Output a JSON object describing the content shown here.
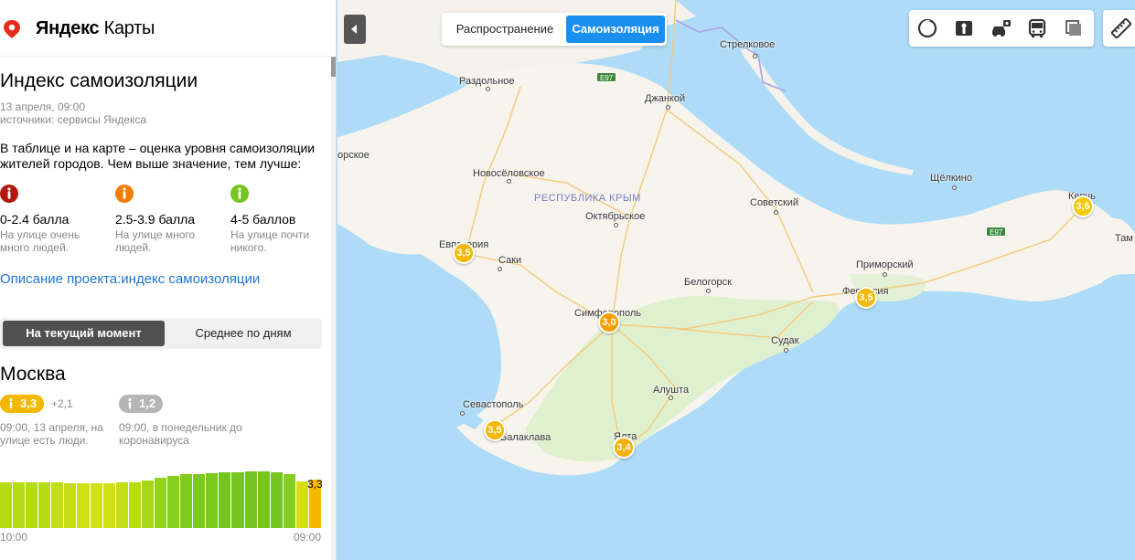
{
  "app": {
    "logo_bold": "Яндекс",
    "logo_rest": " Карты"
  },
  "panel": {
    "title": "Индекс самоизоляции",
    "date": "13 апреля, 09:00",
    "sources": "источники: сервисы Яндекса",
    "description": "В таблице и на карте – оценка уровня самоизоляции жителей городов. Чем выше значение, тем лучше:",
    "legend": [
      {
        "range": "0-2.4 балла",
        "note": "На улице очень много людей.",
        "color": "#b3190e"
      },
      {
        "range": "2.5-3.9 балла",
        "note": "На улице много людей.",
        "color": "#f57c00"
      },
      {
        "range": "4-5 баллов",
        "note": "На улице почти никого.",
        "color": "#76c41f"
      }
    ],
    "project_link": "Описание проекта:индекс самоизоляции",
    "tabs": {
      "current": "На текущий момент",
      "daily": "Среднее по дням"
    },
    "city": {
      "name": "Москва",
      "current_value": "3,3",
      "delta": "+2,1",
      "baseline_value": "1,2",
      "current_note": "09:00, 13 апреля, на улице есть люди.",
      "baseline_note": "09:00, в понедельник до коронавируса"
    },
    "hourly_chart": {
      "last_label": "3,3",
      "tick_start": "10:00",
      "tick_end": "09:00"
    }
  },
  "chart_data": {
    "type": "bar",
    "title": "",
    "xlabel": "",
    "ylabel": "",
    "x_range": [
      "10:00",
      "09:00"
    ],
    "ylim": [
      0,
      5
    ],
    "values": [
      2.8,
      2.8,
      2.8,
      2.75,
      2.75,
      2.7,
      2.7,
      2.7,
      2.7,
      2.75,
      2.8,
      2.9,
      3.05,
      3.15,
      3.25,
      3.3,
      3.35,
      3.4,
      3.4,
      3.45,
      3.45,
      3.4,
      3.3,
      2.85,
      2.95
    ],
    "colors": [
      "#b5db13",
      "#b5db13",
      "#b5db13",
      "#b5db13",
      "#c3de14",
      "#c3de14",
      "#d0e018",
      "#d0e018",
      "#d0e018",
      "#c3de14",
      "#b5db13",
      "#a6d817",
      "#96d31b",
      "#86cf1e",
      "#7fcc1f",
      "#79c920",
      "#79c920",
      "#76c41f",
      "#76c41f",
      "#76c41f",
      "#76c41f",
      "#76c41f",
      "#86cf1e",
      "#d6e011",
      "#f5b800"
    ]
  },
  "map": {
    "mode_spread": "Распространение",
    "mode_isolation": "Самоизоляция",
    "region": "РЕСПУБЛИКА КРЫМ",
    "road_e97": "E97",
    "places": [
      {
        "name": "Стрелковое"
      },
      {
        "name": "Раздольное"
      },
      {
        "name": "Джанкой"
      },
      {
        "name": "орское"
      },
      {
        "name": "Новосёловское"
      },
      {
        "name": "Октябрьское"
      },
      {
        "name": "Советский"
      },
      {
        "name": "Щёлкино"
      },
      {
        "name": "Керчь"
      },
      {
        "name": "Евпатория"
      },
      {
        "name": "Саки"
      },
      {
        "name": "Приморский"
      },
      {
        "name": "Белогорск"
      },
      {
        "name": "Феодосия"
      },
      {
        "name": "Симферополь"
      },
      {
        "name": "Судак"
      },
      {
        "name": "Алушта"
      },
      {
        "name": "Севастополь"
      },
      {
        "name": "Балаклава"
      },
      {
        "name": "Ялта"
      },
      {
        "name": "Там"
      }
    ],
    "markers": [
      {
        "city": "Евпатория",
        "value": "3,5",
        "color": "#f5b800"
      },
      {
        "city": "Симферополь",
        "value": "3,0",
        "color": "#f5a000"
      },
      {
        "city": "Феодосия",
        "value": "3,5",
        "color": "#f5b800"
      },
      {
        "city": "Керчь",
        "value": "3,6",
        "color": "#f5c800"
      },
      {
        "city": "Севастополь",
        "value": "3,5",
        "color": "#f5b800"
      },
      {
        "city": "Ялта",
        "value": "3,4",
        "color": "#f5b000"
      }
    ]
  }
}
